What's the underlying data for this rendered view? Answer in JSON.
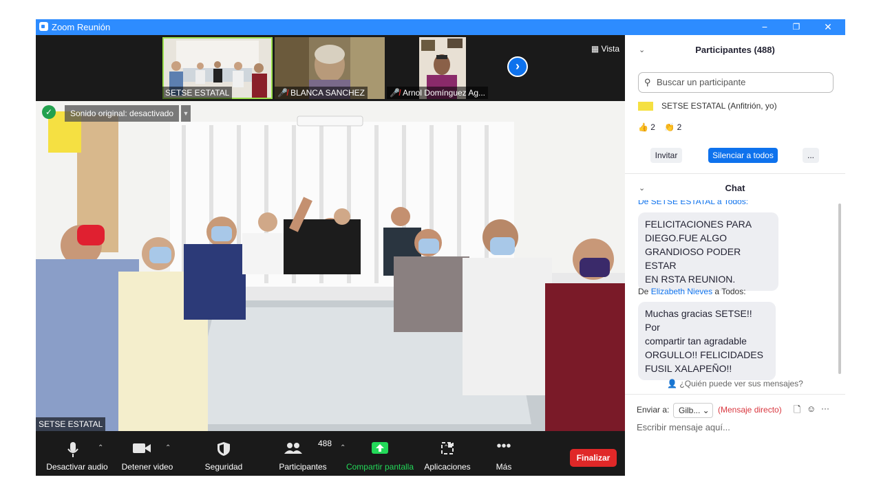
{
  "titlebar": {
    "title": "Zoom Reunión",
    "minimize": "−",
    "restore": "❐",
    "close": "✕"
  },
  "gallery": {
    "view_label": "Vista",
    "thumbnails": [
      {
        "name": "SETSE ESTATAL",
        "muted": false
      },
      {
        "name": "BLANCA SANCHEZ",
        "muted": true
      },
      {
        "name": "Arnol Domínguez Ag...",
        "muted": true
      }
    ],
    "next_arrow": "›"
  },
  "main_video": {
    "original_sound": "Sonido original: desactivado",
    "speaker_name": "SETSE ESTATAL"
  },
  "toolbar": {
    "mute_label": "Desactivar audio",
    "video_label": "Detener video",
    "security_label": "Seguridad",
    "participants_label": "Participantes",
    "participants_count": "488",
    "share_label": "Compartir pantalla",
    "apps_label": "Aplicaciones",
    "more_label": "Más",
    "end_label": "Finalizar",
    "share_color": "#23d959",
    "end_color": "#e02828"
  },
  "participants_panel": {
    "header": "Participantes (488)",
    "search_placeholder": "Buscar un participante",
    "first_row": "SETSE ESTATAL (Anfitrión, yo)",
    "reactions": [
      {
        "icon": "thumbs-up",
        "glyph": "👍",
        "count": "2"
      },
      {
        "icon": "clap",
        "glyph": "👏",
        "count": "2"
      }
    ],
    "invite": "Invitar",
    "mute_all": "Silenciar a todos",
    "more": "..."
  },
  "chat": {
    "header": "Chat",
    "cut_line": "De SETSE ESTATAL a Todos:",
    "messages": [
      {
        "text_lines": [
          "FELICITACIONES PARA",
          "DIEGO.FUE ALGO",
          "GRANDIOSO PODER ESTAR",
          "EN RSTA REUNION."
        ]
      },
      {
        "from_prefix": "De ",
        "from": "Elizabeth Nieves",
        "to": " a Todos:",
        "text_lines": [
          "Muchas gracias SETSE!! Por",
          "compartir tan agradable",
          "ORGULLO!! FELICIDADES",
          "FUSIL XALAPEÑO!!"
        ]
      }
    ],
    "who_can_see": "¿Quién puede ver sus mensajes?",
    "send_to_label": "Enviar a:",
    "recipient": "Gilb...",
    "direct_message": "(Mensaje directo)",
    "input_placeholder": "Escribir mensaje aquí..."
  }
}
